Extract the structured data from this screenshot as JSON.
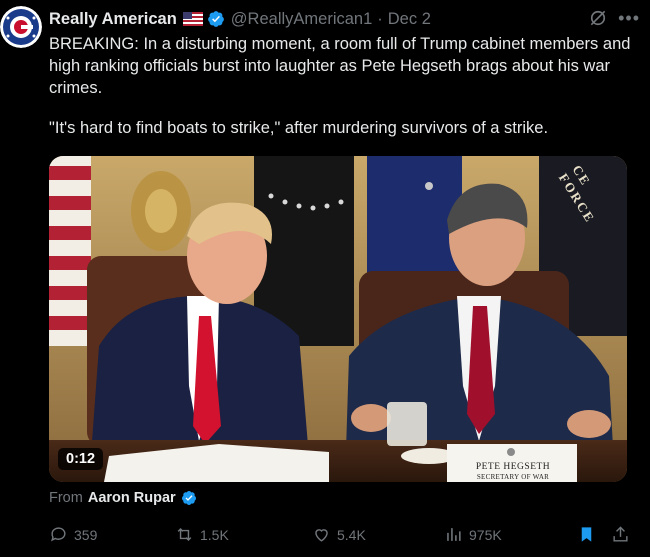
{
  "author": {
    "display_name": "Really American",
    "flag_emoji": "🇺🇸",
    "handle": "@ReallyAmerican1",
    "separator": "·",
    "date": "Dec 2",
    "avatar_letter": "G"
  },
  "tweet": {
    "paragraph_1": "BREAKING: In a disturbing moment, a room full of Trump cabinet members and high ranking officials burst into laughter as Pete Hegseth brags about his war crimes.",
    "paragraph_2": "\"It's hard to find boats to strike,\" after murdering survivors of a strike."
  },
  "video": {
    "timestamp": "0:12",
    "nameplate_name": "PETE HEGSETH",
    "nameplate_title": "SECRETARY OF WAR",
    "flag_text": "CE FORCE"
  },
  "from": {
    "label": "From",
    "author": "Aaron Rupar"
  },
  "actions": {
    "replies": "359",
    "reposts": "1.5K",
    "likes": "5.4K",
    "views": "975K"
  },
  "colors": {
    "background": "#000000",
    "text": "#e7e9ea",
    "muted": "#71767b",
    "verified": "#1d9bf0",
    "bookmark": "#1d9bf0"
  }
}
